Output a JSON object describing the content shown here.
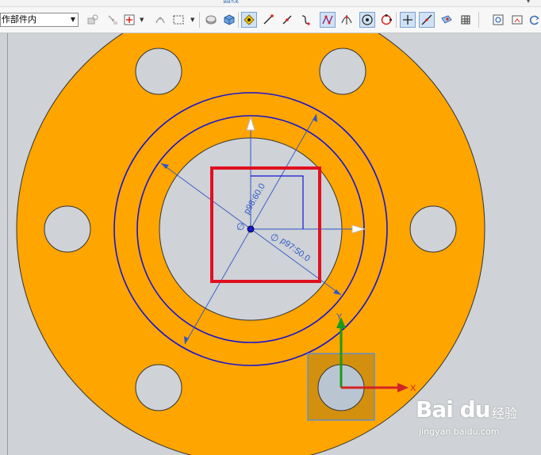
{
  "window": {
    "group_caption": "曲线"
  },
  "toolbar": {
    "selection_filter": {
      "value": "作部件内"
    },
    "buttons": [
      {
        "name": "find-in-tree-icon",
        "active": false
      },
      {
        "name": "select-by-name-icon",
        "active": false
      },
      {
        "name": "snap-point-icon",
        "active": false
      },
      {
        "name": "general-point-icon",
        "active": false
      },
      {
        "name": "box-select-icon",
        "active": false
      },
      {
        "name": "shaded-view-icon",
        "active": false
      },
      {
        "name": "cube-view-icon",
        "active": false
      },
      {
        "name": "snap-all-points-icon",
        "active": true
      },
      {
        "name": "line-snap-icon",
        "active": false
      },
      {
        "name": "arc-snap-icon",
        "active": false
      },
      {
        "name": "curve-snap-icon",
        "active": false
      },
      {
        "name": "control-point-snap-icon",
        "active": true
      },
      {
        "name": "intersection-snap-icon",
        "active": false
      },
      {
        "name": "arc-center-snap-icon",
        "active": true
      },
      {
        "name": "quadrant-snap-icon",
        "active": false
      },
      {
        "name": "point-snap-icon",
        "active": true
      },
      {
        "name": "point-on-curve-snap-icon",
        "active": true
      },
      {
        "name": "face-point-snap-icon",
        "active": false
      },
      {
        "name": "bounded-grid-icon",
        "active": false
      },
      {
        "name": "fit-view-icon",
        "active": false
      },
      {
        "name": "display-mode-icon",
        "active": false
      },
      {
        "name": "rotate-view-icon",
        "active": false
      }
    ]
  },
  "canvas": {
    "colors": {
      "background": "#cfd2d6",
      "part_fill": "#ffa500",
      "sketch_curve": "#1414d2",
      "dimension": "#2f57c9",
      "highlight_box": "#e01020"
    },
    "dimensions": [
      {
        "name": "inner-ring-diameter-dim",
        "text": "p98:60.0"
      },
      {
        "name": "outer-ring-diameter-dim",
        "text": "p97:50.0"
      }
    ],
    "axis_labels": {
      "x": "X",
      "y": "Y"
    }
  },
  "watermark": {
    "logo": "Bai du",
    "suffix": "经验",
    "url": "jingyan.baidu.com"
  }
}
